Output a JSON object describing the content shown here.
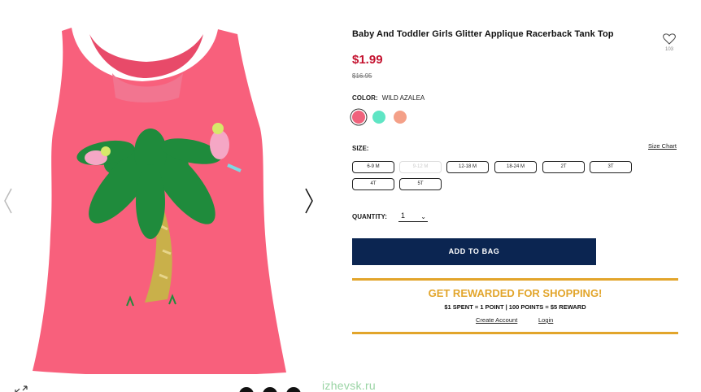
{
  "product": {
    "title": "Baby And Toddler Girls Glitter Applique Racerback Tank Top",
    "price": "$1.99",
    "original_price": "$16.95",
    "wishlist_count": "103",
    "image_icon": "pink-tank-top-palm-tree-parrots"
  },
  "color": {
    "label": "COLOR:",
    "value": "WILD AZALEA",
    "swatches": [
      {
        "name": "wild-azalea",
        "hex": "#f0627c",
        "selected": true
      },
      {
        "name": "mint",
        "hex": "#5fe5c4",
        "selected": false
      },
      {
        "name": "coral",
        "hex": "#f4a088",
        "selected": false
      }
    ]
  },
  "size": {
    "label": "SIZE:",
    "chart_link": "Size Chart",
    "options": [
      {
        "label": "6-9 M",
        "available": true
      },
      {
        "label": "9-12 M",
        "available": false
      },
      {
        "label": "12-18 M",
        "available": true
      },
      {
        "label": "18-24 M",
        "available": true
      },
      {
        "label": "2T",
        "available": true
      },
      {
        "label": "3T",
        "available": true
      },
      {
        "label": "4T",
        "available": true
      },
      {
        "label": "5T",
        "available": true
      }
    ]
  },
  "quantity": {
    "label": "QUANTITY:",
    "value": "1"
  },
  "add_to_bag_label": "ADD TO BAG",
  "rewards": {
    "title": "GET REWARDED FOR SHOPPING!",
    "subtitle": "$1 SPENT = 1 POINT | 100 POINTS = $5 REWARD",
    "create_account": "Create Account",
    "login": "Login"
  },
  "watermark": "izhevsk.ru",
  "colors": {
    "price_red": "#c4122f",
    "navy": "#0b2551",
    "gold": "#e2a52b",
    "shirt_pink": "#f8607c"
  }
}
